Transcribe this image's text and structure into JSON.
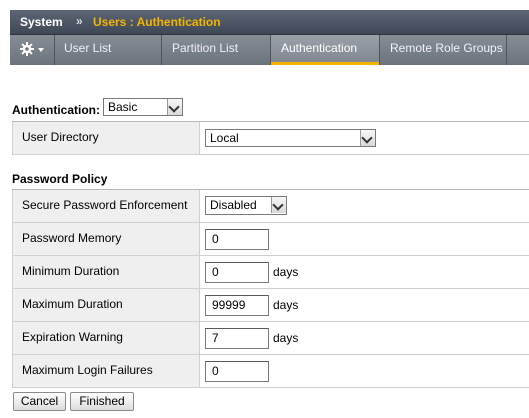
{
  "breadcrumb": {
    "root": "System",
    "separator": "»",
    "page": "Users : Authentication"
  },
  "tabs": [
    {
      "label": "User List"
    },
    {
      "label": "Partition List"
    },
    {
      "label": "Authentication",
      "active": true
    },
    {
      "label": "Remote Role Groups"
    }
  ],
  "toolbar": {
    "menu_icon": "gear-icon"
  },
  "authentication": {
    "label": "Authentication:",
    "selected": "Basic",
    "rows": [
      {
        "label": "User Directory",
        "value": "Local"
      }
    ]
  },
  "password_policy": {
    "title": "Password Policy",
    "rows": [
      {
        "label": "Secure Password Enforcement",
        "value": "Disabled"
      },
      {
        "label": "Password Memory",
        "value": "0"
      },
      {
        "label": "Minimum Duration",
        "value": "0",
        "unit": "days"
      },
      {
        "label": "Maximum Duration",
        "value": "99999",
        "unit": "days"
      },
      {
        "label": "Expiration Warning",
        "value": "7",
        "unit": "days"
      },
      {
        "label": "Maximum Login Failures",
        "value": "0"
      }
    ]
  },
  "buttons": {
    "cancel": "Cancel",
    "finished": "Finished"
  },
  "colors": {
    "accent": "#f4b400",
    "header": "#4a5462",
    "tabbar": "#78808a"
  }
}
